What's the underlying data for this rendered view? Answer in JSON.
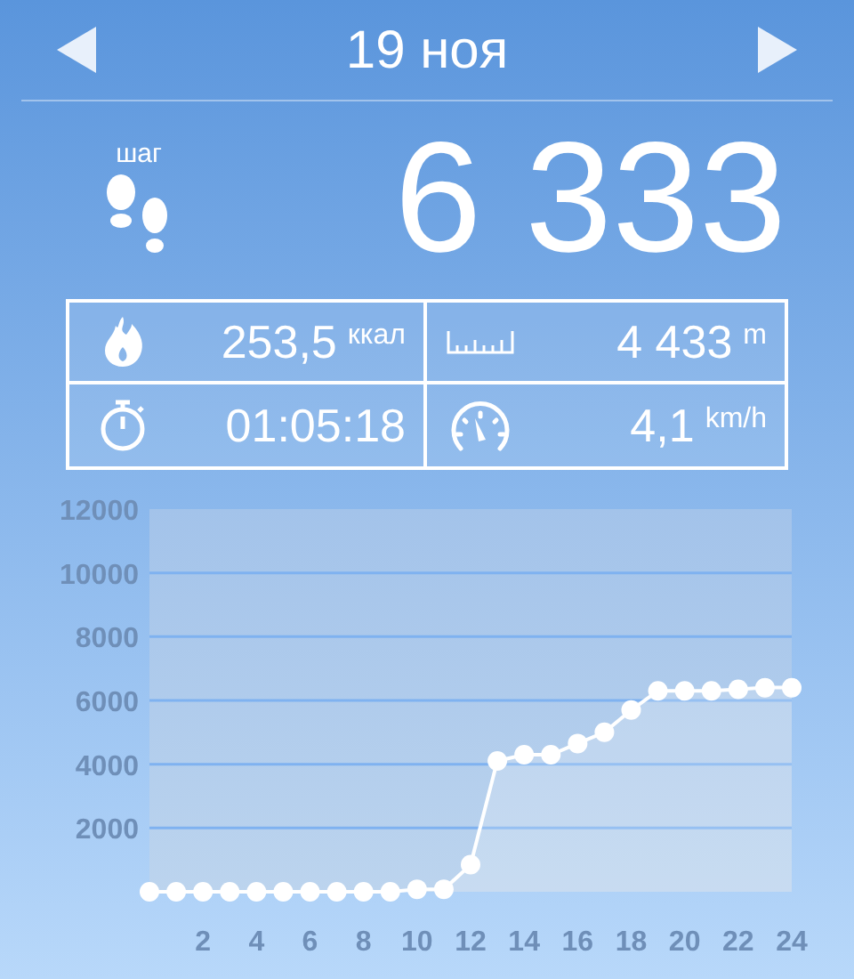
{
  "header": {
    "title": "19 ноя"
  },
  "steps": {
    "label": "шаг",
    "value": "6 333"
  },
  "stats": [
    {
      "kind": "calories",
      "value": "253,5",
      "unit": "ккал"
    },
    {
      "kind": "distance",
      "value": "4 433",
      "unit": "m"
    },
    {
      "kind": "duration",
      "value": "01:05:18"
    },
    {
      "kind": "speed",
      "value": "4,1",
      "unit": "km/h"
    }
  ],
  "chart": {
    "chart_data": {
      "type": "area",
      "x": [
        0,
        1,
        2,
        3,
        4,
        5,
        6,
        7,
        8,
        9,
        10,
        11,
        12,
        13,
        14,
        15,
        16,
        17,
        18,
        19,
        20,
        21,
        22,
        23,
        24
      ],
      "grid": true,
      "series": [
        {
          "color": "#ffffff",
          "values": [
            0,
            0,
            0,
            0,
            0,
            0,
            0,
            0,
            0,
            0,
            80,
            80,
            850,
            4100,
            4300,
            4300,
            4650,
            5000,
            5700,
            6300,
            6300,
            6300,
            6350,
            6400,
            6400
          ]
        }
      ],
      "xlim": [
        0,
        24
      ],
      "ylim": [
        0,
        12000
      ],
      "xticks": [
        2,
        4,
        6,
        8,
        10,
        12,
        14,
        16,
        18,
        20,
        22,
        24
      ],
      "yticks": [
        2000,
        4000,
        6000,
        8000,
        10000,
        12000
      ]
    }
  }
}
